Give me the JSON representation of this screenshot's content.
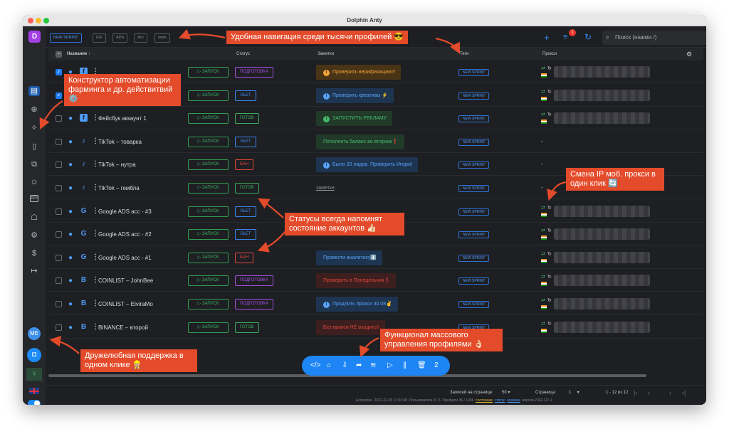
{
  "window": {
    "title": "Dolphin Anty"
  },
  "sidebar": {
    "logo": "D",
    "avatar": "ME",
    "icons": [
      "browser-profiles-icon",
      "proxy-icon",
      "automation-icon",
      "bookmarks-icon",
      "extensions-icon",
      "team-icon",
      "api-icon",
      "robot-icon",
      "settings-icon",
      "billing-icon",
      "logout-icon"
    ]
  },
  "topbar": {
    "chips": [
      "NEW SPRINT",
      "IG6",
      "ADS",
      "Acc",
      "work"
    ],
    "notification_count": "1",
    "search_placeholder": "Поиск (нажми /)"
  },
  "table": {
    "columns": {
      "name": "Название",
      "status": "Статус",
      "notes": "Заметки",
      "tags": "Теги",
      "proxy": "Прокси"
    },
    "launch_label": "▷ ЗАПУСК",
    "rows": [
      {
        "name": "",
        "checked": true,
        "platform": "fb",
        "status": "ПОДГОТОВКА",
        "status_color": "#a44de2",
        "note": "Проверить верификацию!!!",
        "note_icon": "i",
        "note_bg": "#4a3416",
        "note_fg": "#f2a43a",
        "tag": "NEW SPRINT",
        "proxy": "ip"
      },
      {
        "name": "",
        "checked": true,
        "platform": "fb",
        "status": "ЛЬЕТ",
        "status_color": "#3a86f2",
        "note": "Проверить креативы ⚡",
        "note_icon": "i",
        "note_bg": "#1e3552",
        "note_fg": "#58a2f7",
        "tag": "NEW SPRINT",
        "proxy": "ip"
      },
      {
        "name": "Фейсбук аккаунт 1",
        "checked": false,
        "platform": "fb",
        "status": "ГОТОВ",
        "status_color": "#3aaa5c",
        "note": "ЗАПУСТИТЬ РЕКЛАМУ",
        "note_icon": "i",
        "note_bg": "#213a29",
        "note_fg": "#47bb6c",
        "tag": "NEW SPRINT",
        "proxy": "ip"
      },
      {
        "name": "TikTok – товарка",
        "checked": false,
        "platform": "tt",
        "status": "ЛЬЕТ",
        "status_color": "#3a86f2",
        "note": "Пополнить баланс во вторник❗",
        "note_icon": "",
        "note_bg": "#213a29",
        "note_fg": "#47bb6c",
        "tag": "NEW SPRINT",
        "proxy": "-"
      },
      {
        "name": "TikTok – нутра",
        "checked": false,
        "platform": "tt",
        "status": "БАН",
        "status_color": "#e0463a",
        "note": "Было 20 лидов. Проверить Игорю!",
        "note_icon": "i",
        "note_bg": "#1e3552",
        "note_fg": "#58a2f7",
        "tag": "NEW SPRINT",
        "proxy": "-"
      },
      {
        "name": "TikTok – гембла",
        "checked": false,
        "platform": "tt",
        "status": "ГОТОВ",
        "status_color": "#3aaa5c",
        "note": "заметки",
        "note_icon": "",
        "note_bg": "",
        "note_fg": "",
        "tag": "NEW SPRINT",
        "proxy": "-"
      },
      {
        "name": "Google ADS acc - #3",
        "checked": false,
        "platform": "g",
        "status": "ЛЬЕТ",
        "status_color": "#3a86f2",
        "note": "",
        "note_icon": "",
        "note_bg": "",
        "note_fg": "",
        "tag": "NEW SPRINT",
        "proxy": "ip"
      },
      {
        "name": "Google ADS acc - #2",
        "checked": false,
        "platform": "g",
        "status": "ЛЬЕТ",
        "status_color": "#3a86f2",
        "note": "",
        "note_icon": "",
        "note_bg": "",
        "note_fg": "",
        "tag": "NEW SPRINT",
        "proxy": "ip"
      },
      {
        "name": "Google ADS acc - #1",
        "checked": false,
        "platform": "g",
        "status": "БАН",
        "status_color": "#e0463a",
        "note": "Провести аналитику⬇️",
        "note_icon": "",
        "note_bg": "#1e3552",
        "note_fg": "#58a2f7",
        "tag": "NEW SPRINT",
        "proxy": "ip"
      },
      {
        "name": "COINLIST – JohnBee",
        "checked": false,
        "platform": "b",
        "status": "ПОДГОТОВКА",
        "status_color": "#a44de2",
        "note": "Проверить в Понедельник❗",
        "note_icon": "",
        "note_bg": "#3e1f1f",
        "note_fg": "#e0463a",
        "tag": "NEW SPRINT",
        "proxy": "ip"
      },
      {
        "name": "COINLIST – ElviraMo",
        "checked": false,
        "platform": "b",
        "status": "ПОДГОТОВКА",
        "status_color": "#a44de2",
        "note": "Продлить прокси 30.08✌️",
        "note_icon": "i",
        "note_bg": "#1e3552",
        "note_fg": "#58a2f7",
        "tag": "NEW SPRINT",
        "proxy": "ip"
      },
      {
        "name": "BINANCE – второй",
        "checked": false,
        "platform": "b",
        "status": "ГОТОВ",
        "status_color": "#3aaa5c",
        "note": "Без прокси НЕ входить!!",
        "note_icon": "",
        "note_bg": "#3e1f1f",
        "note_fg": "#e0463a",
        "tag": "NEW SPRINT",
        "proxy": "ip"
      }
    ]
  },
  "mass_toolbar": {
    "icons": [
      "code-icon",
      "tag-icon",
      "import-icon",
      "share-icon",
      "wifi-icon",
      "play-icon",
      "pause-icon",
      "trash-icon"
    ],
    "count": "2"
  },
  "pagination": {
    "per_page_label": "Записей на странице:",
    "per_page": "50",
    "page_label": "Страница:",
    "page": "1",
    "range": "1 - 12 из 12"
  },
  "footer": {
    "plan": "Enterprise",
    "date": "2022-22-09 12:02:48",
    "users_label": "Пользователи 3 / 3",
    "profiles_label": "Профили 35 / 1000",
    "link1": "состояние",
    "link2": "статус",
    "link3": "корзина",
    "version": "версия 2022.117.1"
  },
  "callouts": {
    "nav": "Удобная навигация среди тысячи профилей 😎",
    "constructor": "Конструктор автоматизации фарминга и др. действитвий ⚙️",
    "ip": "Смена IP моб. прокси в один клик 🔄",
    "statuses": "Статусы всегда напомнят состояние аккаунтов 👍🏻",
    "mass": "Функционал массового управления профилями 👌🏻",
    "support": "Дружелюбная поддержка в одном клике 👷🏼"
  }
}
